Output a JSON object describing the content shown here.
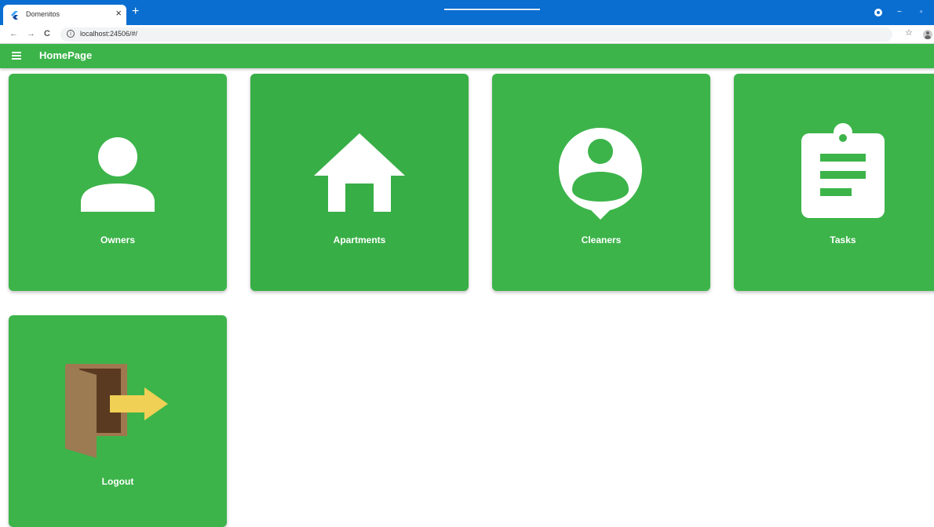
{
  "browser": {
    "tab_title": "Domenitos",
    "tab_close": "×",
    "new_tab": "+",
    "url": "localhost:24506/#/",
    "back": "←",
    "forward": "→",
    "reload": "C",
    "star": "☆",
    "minimize": "−",
    "restore": "▫"
  },
  "appbar": {
    "title": "HomePage"
  },
  "tiles": [
    {
      "label": "Owners",
      "icon": "person-icon"
    },
    {
      "label": "Apartments",
      "icon": "house-icon"
    },
    {
      "label": "Cleaners",
      "icon": "person-pin-icon"
    },
    {
      "label": "Tasks",
      "icon": "clipboard-icon"
    },
    {
      "label": "Logout",
      "icon": "door-exit-icon"
    }
  ],
  "colors": {
    "tile_green": "#3cb44a",
    "browser_blue": "#0a6ed1",
    "door_brown": "#a07850",
    "arrow_yellow": "#f0d055"
  }
}
